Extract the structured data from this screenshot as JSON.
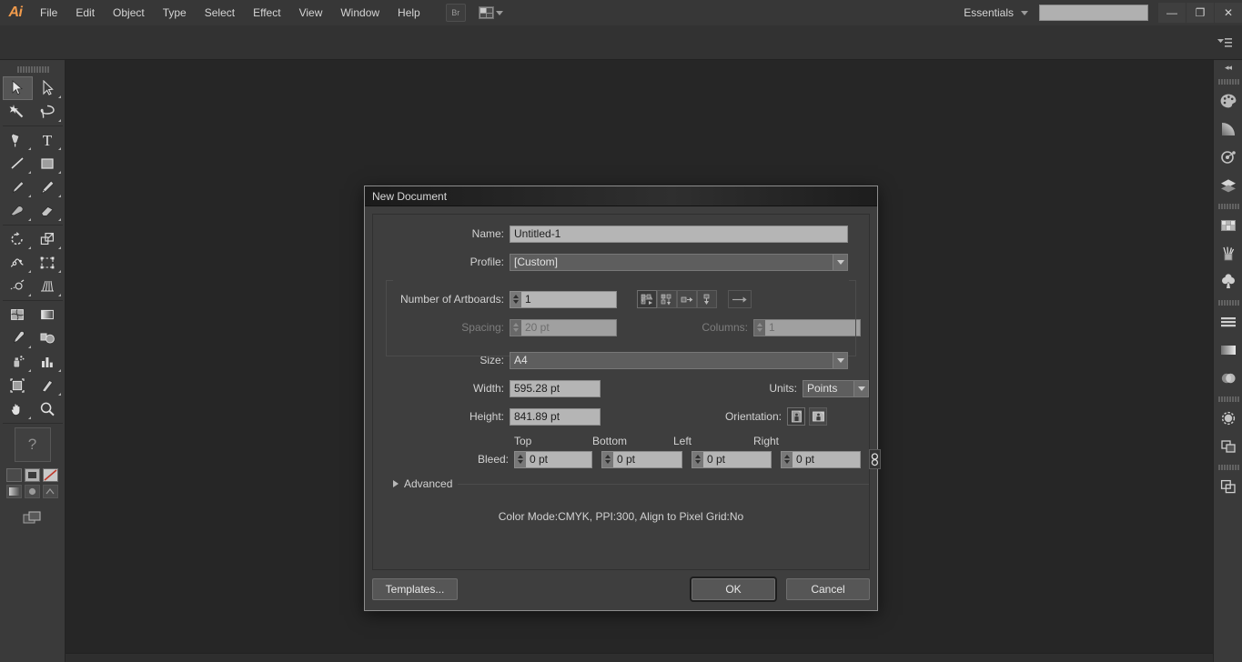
{
  "app": {
    "logo": "Ai",
    "menus": [
      "File",
      "Edit",
      "Object",
      "Type",
      "Select",
      "Effect",
      "View",
      "Window",
      "Help"
    ],
    "bridge_button": "Br",
    "arrange_icon": "arrange-documents-icon",
    "workspace": "Essentials",
    "search_placeholder": "",
    "search_value": "",
    "window_controls": {
      "minimize": "—",
      "restore": "❐",
      "close": "✕"
    }
  },
  "toolbox": {
    "tools": [
      "selection-tool",
      "direct-selection-tool",
      "magic-wand-tool",
      "lasso-tool",
      "pen-tool",
      "type-tool",
      "line-segment-tool",
      "rectangle-tool",
      "paintbrush-tool",
      "pencil-tool",
      "blob-brush-tool",
      "eraser-tool",
      "rotate-tool",
      "scale-tool",
      "width-tool",
      "free-transform-tool",
      "shape-builder-tool",
      "perspective-grid-tool",
      "mesh-tool",
      "gradient-tool",
      "eyedropper-tool",
      "blend-tool",
      "symbol-sprayer-tool",
      "column-graph-tool",
      "artboard-tool",
      "slice-tool",
      "hand-tool",
      "zoom-tool"
    ],
    "help_label": "?",
    "fill_stroke": [
      "fill-swatch",
      "stroke-swatch",
      "none-swatch"
    ],
    "color_modes": [
      "gradient-mode",
      "color-mode",
      "none-mode"
    ],
    "screen_mode": "change-screen-mode"
  },
  "dock": {
    "expand_label": "◂◂",
    "icons": [
      "color-panel",
      "gradient-panel",
      "stroke-panel",
      "layers-panel",
      "swatches-panel",
      "brushes-panel",
      "symbols-panel",
      "align-panel",
      "gradient2-panel",
      "transparency-panel",
      "appearance-panel",
      "artboards-panel",
      "document-panel"
    ]
  },
  "dialog": {
    "title": "New Document",
    "name": {
      "label": "Name:",
      "value": "Untitled-1"
    },
    "profile": {
      "label": "Profile:",
      "value": "[Custom]"
    },
    "artboards": {
      "label": "Number of Artboards:",
      "value": "1"
    },
    "arrangement_buttons": [
      "grid-by-row-icon",
      "grid-by-column-icon",
      "arrange-left-to-right-icon",
      "arrange-top-to-bottom-icon"
    ],
    "arrangement_direction": "change-to-right-to-left-icon",
    "spacing": {
      "label": "Spacing:",
      "value": "20 pt",
      "disabled": true
    },
    "columns": {
      "label": "Columns:",
      "value": "1",
      "disabled": true
    },
    "size": {
      "label": "Size:",
      "value": "A4"
    },
    "width": {
      "label": "Width:",
      "value": "595.28 pt"
    },
    "height": {
      "label": "Height:",
      "value": "841.89 pt"
    },
    "units": {
      "label": "Units:",
      "value": "Points"
    },
    "orientation": {
      "label": "Orientation:",
      "portrait_icon": "portrait-orientation-icon",
      "landscape_icon": "landscape-orientation-icon",
      "selected": "portrait"
    },
    "bleed": {
      "label": "Bleed:",
      "headers": {
        "top": "Top",
        "bottom": "Bottom",
        "left": "Left",
        "right": "Right"
      },
      "top": "0 pt",
      "bottom": "0 pt",
      "left": "0 pt",
      "right": "0 pt",
      "link_icon": "link-bleed-values-icon"
    },
    "advanced": {
      "label": "Advanced",
      "expanded": false
    },
    "summary": "Color Mode:CMYK, PPI:300, Align to Pixel Grid:No",
    "buttons": {
      "templates": "Templates...",
      "ok": "OK",
      "cancel": "Cancel"
    }
  },
  "colors": {
    "menubar_bg": "#373737",
    "panel_bg": "#3a3a3a",
    "canvas_bg": "#262626",
    "dialog_bg": "#3e3e3e",
    "field_bg": "#b5b5b5",
    "text": "#d2d2d2",
    "accent": "#f09a4b"
  }
}
